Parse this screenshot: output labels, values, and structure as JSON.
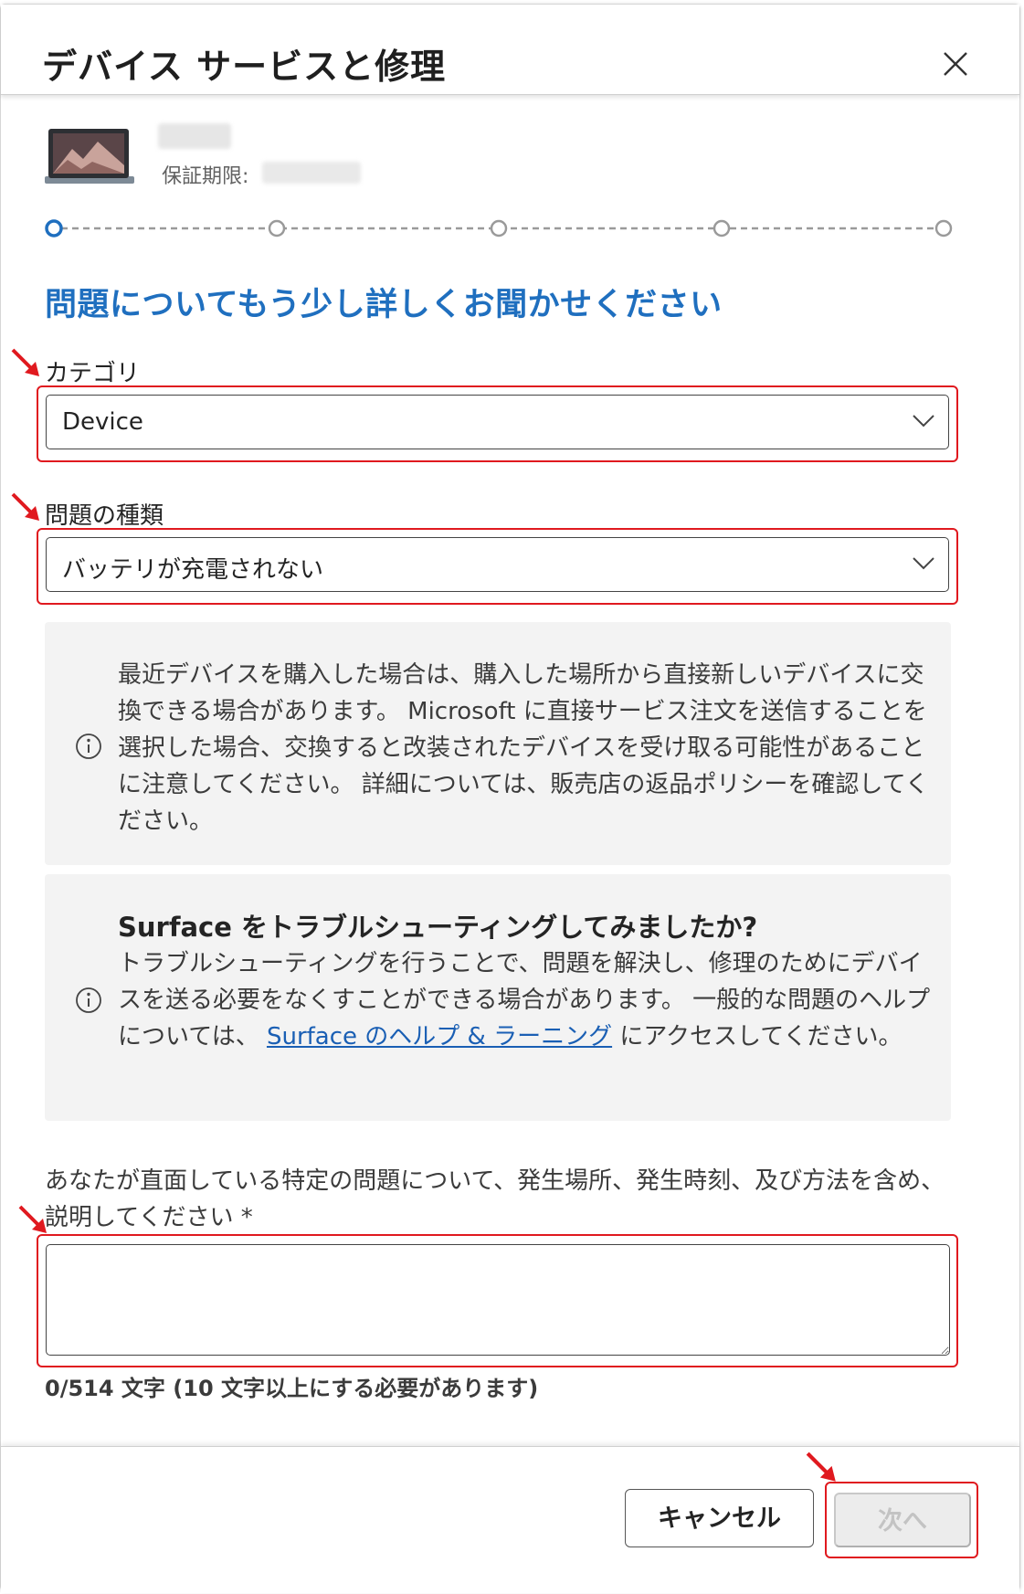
{
  "dialog": {
    "title": "デバイス サービスと修理",
    "close_icon": "close-icon"
  },
  "device": {
    "image_icon": "surface-device-image",
    "warranty_label": "保証期限:"
  },
  "stepper": {
    "total_steps": 5,
    "current_step": 1
  },
  "form": {
    "heading": "問題についてもう少し詳しくお聞かせください",
    "category": {
      "label": "カテゴリ",
      "value": "Device"
    },
    "problem_type": {
      "label": "問題の種類",
      "value": "バッテリが充電されない"
    },
    "notice": {
      "icon": "info-icon",
      "text": "最近デバイスを購入した場合は、購入した場所から直接新しいデバイスに交換できる場合があります。 Microsoft に直接サービス注文を送信することを選択した場合、交換すると改装されたデバイスを受け取る可能性があることに注意してください。 詳細については、販売店の返品ポリシーを確認してください。"
    },
    "troubleshoot": {
      "icon": "info-icon",
      "title": "Surface をトラブルシューティングしてみましたか?",
      "text_before": "トラブルシューティングを行うことで、問題を解決し、修理のためにデバイスを送る必要をなくすことができる場合があります。 一般的な問題のヘルプについては、 ",
      "link": "Surface のヘルプ & ラーニング",
      "text_after": " にアクセスしてください。"
    },
    "description": {
      "label": "あなたが直面している特定の問題について、発生場所、発生時刻、及び方法を含め、説明してください *",
      "value": "",
      "counter": "0/514 文字 (10 文字以上にする必要があります)"
    }
  },
  "footer": {
    "cancel_label": "キャンセル",
    "next_label": "次へ"
  },
  "colors": {
    "accent": "#1f6fbf",
    "highlight": "#e0191f",
    "link": "#1a5fb4",
    "info_bg": "#f3f3f3"
  }
}
